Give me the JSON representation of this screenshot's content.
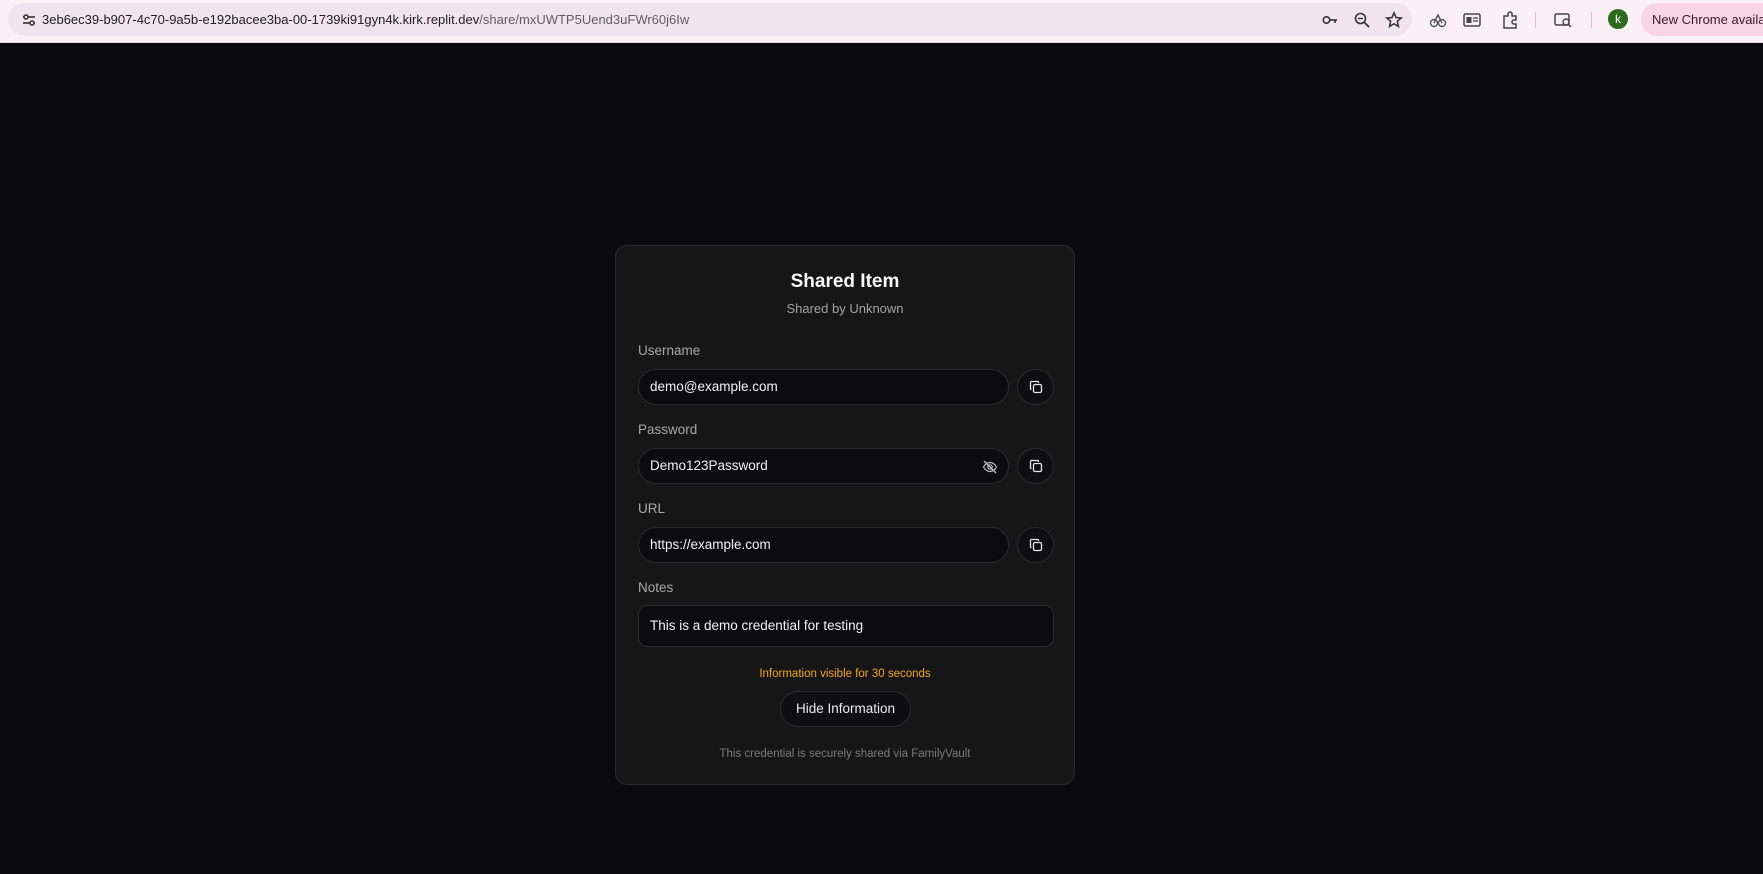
{
  "browser": {
    "url_host": "3eb6ec39-b907-4c70-9a5b-e192bacee3ba-00-1739ki91gyn4k.kirk.replit.dev",
    "url_path": "/share/mxUWTP5Uend3uFWr60j6Iw",
    "avatar_letter": "k",
    "update_label": "New Chrome available",
    "icons": [
      "site-settings-icon",
      "key-icon",
      "zoom-icon",
      "star-icon",
      "performance-icon",
      "reader-mode-icon",
      "extensions-icon",
      "tab-search-icon"
    ]
  },
  "card": {
    "title": "Shared Item",
    "subtitle": "Shared by Unknown",
    "fields": [
      {
        "label": "Username",
        "value": "demo@example.com"
      },
      {
        "label": "Password",
        "value": "Demo123Password"
      },
      {
        "label": "URL",
        "value": "https://example.com"
      }
    ],
    "notes_label": "Notes",
    "notes_value": "This is a demo credential for testing",
    "timer_text": "Information visible for 30 seconds",
    "hide_button": "Hide Information",
    "footer": "This credential is securely shared via FamilyVault",
    "accent_color": "#f5a524"
  }
}
